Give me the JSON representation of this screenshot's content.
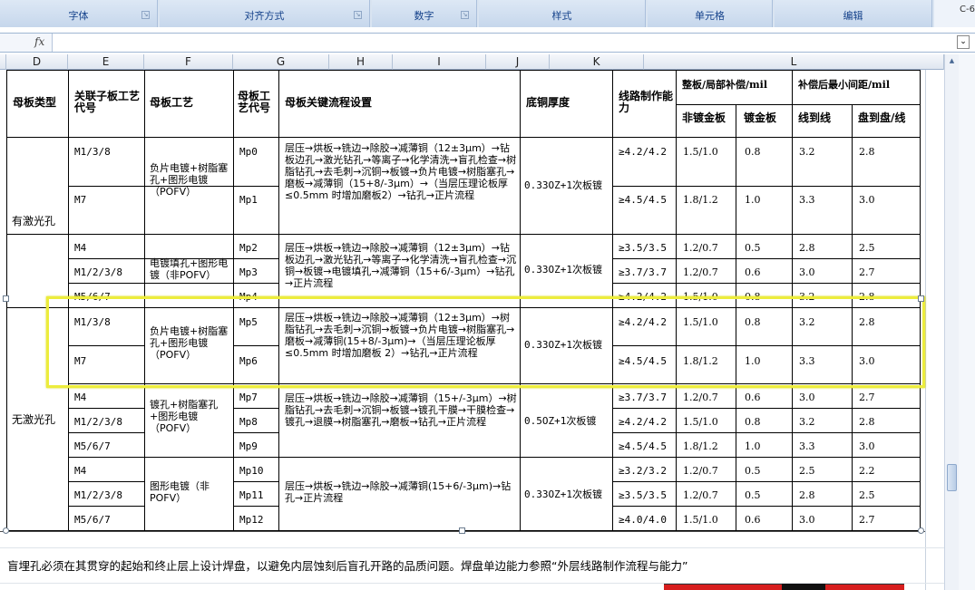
{
  "ribbon": {
    "groups": [
      "字体",
      "对齐方式",
      "数字",
      "样式",
      "单元格",
      "编辑"
    ],
    "right_fragment": "C‑6"
  },
  "formula_bar": {
    "fx_label": "fx",
    "value": ""
  },
  "columns": [
    "D",
    "E",
    "F",
    "G",
    "H",
    "I",
    "J",
    "K",
    "L"
  ],
  "table": {
    "headers": {
      "board_type": "母板类型",
      "sub_code": "关联子板工艺代号",
      "process": "母板工艺",
      "process_code": "母板工艺代号",
      "flow": "母板关键流程设置",
      "cu": "底铜厚度",
      "capability": "线路制作能力",
      "comp": "整板/局部补偿/mil",
      "comp_nongold": "非镀金板",
      "comp_gold": "镀金板",
      "spacing": "补偿后最小间距/mil",
      "line_line": "线到线",
      "pad_line": "盘到盘/线"
    },
    "groups": {
      "laser": "有激光孔",
      "nolaser": "无激光孔"
    },
    "processes": [
      "负片电镀+树脂塞孔+图形电镀（POFV）",
      "电镀填孔+图形电镀（非POFV）",
      "负片电镀+树脂塞孔+图形电镀（POFV）",
      "镀孔+树脂塞孔+图形电镀（POFV）",
      "图形电镀（非POFV）"
    ],
    "flows": [
      "层压→烘板→铣边→除胶→减薄铜（12±3μm）→钻板边孔→激光钻孔→等离子→化学清洗→盲孔检查→树脂钻孔→去毛刺→沉铜→板镀→负片电镀→树脂塞孔→磨板→减薄铜（15+8/-3μm）→（当层压理论板厚≤0.5mm 时增加磨板2）→钻孔→正片流程",
      "层压→烘板→铣边→除胶→减薄铜（12±3μm）→钻板边孔→激光钻孔→等离子→化学清洗→盲孔检查→沉铜→板镀→电镀填孔→减薄铜（15+6/-3μm）→钻孔→正片流程",
      "层压→烘板→铣边→除胶→减薄铜（12±3μm）→树脂钻孔→去毛刺→沉铜→板镀→负片电镀→树脂塞孔→磨板→减薄铜(15+8/-3μm)→（当层压理论板厚≤0.5mm 时增加磨板 2）→钻孔→正片流程",
      "层压→烘板→铣边→除胶→减薄铜（15+/-3μm）→树脂钻孔→去毛刺→沉铜→板镀→镀孔干膜→干膜检查→镀孔→退膜→树脂塞孔→磨板→钻孔→正片流程",
      "层压→烘板→铣边→除胶→减薄铜(15+6/-3μm)→钻孔→正片流程"
    ],
    "copper": [
      "0.33OZ+1次板镀",
      "0.33OZ+1次板镀",
      "0.33OZ+1次板镀",
      "0.5OZ+1次板镀",
      "0.33OZ+1次板镀"
    ],
    "rows": [
      {
        "sub": "M1/3/8",
        "code": "Mp0",
        "cap": "≥4.2/4.2",
        "ng": "1.5/1.0",
        "g": "0.8",
        "ll": "3.2",
        "pl": "2.8"
      },
      {
        "sub": "M7",
        "code": "Mp1",
        "cap": "≥4.5/4.5",
        "ng": "1.8/1.2",
        "g": "1.0",
        "ll": "3.3",
        "pl": "3.0"
      },
      {
        "sub": "M4",
        "code": "Mp2",
        "cap": "≥3.5/3.5",
        "ng": "1.2/0.7",
        "g": "0.5",
        "ll": "2.8",
        "pl": "2.5"
      },
      {
        "sub": "M1/2/3/8",
        "code": "Mp3",
        "cap": "≥3.7/3.7",
        "ng": "1.2/0.7",
        "g": "0.6",
        "ll": "3.0",
        "pl": "2.7"
      },
      {
        "sub": "M5/6/7",
        "code": "Mp4",
        "cap": "≥4.2/4.2",
        "ng": "1.5/1.0",
        "g": "0.8",
        "ll": "3.2",
        "pl": "2.8"
      },
      {
        "sub": "M1/3/8",
        "code": "Mp5",
        "cap": "≥4.2/4.2",
        "ng": "1.5/1.0",
        "g": "0.8",
        "ll": "3.2",
        "pl": "2.8"
      },
      {
        "sub": "M7",
        "code": "Mp6",
        "cap": "≥4.5/4.5",
        "ng": "1.8/1.2",
        "g": "1.0",
        "ll": "3.3",
        "pl": "3.0"
      },
      {
        "sub": "M4",
        "code": "Mp7",
        "cap": "≥3.7/3.7",
        "ng": "1.2/0.7",
        "g": "0.6",
        "ll": "3.0",
        "pl": "2.7"
      },
      {
        "sub": "M1/2/3/8",
        "code": "Mp8",
        "cap": "≥4.2/4.2",
        "ng": "1.5/1.0",
        "g": "0.8",
        "ll": "3.2",
        "pl": "2.8"
      },
      {
        "sub": "M5/6/7",
        "code": "Mp9",
        "cap": "≥4.5/4.5",
        "ng": "1.8/1.2",
        "g": "1.0",
        "ll": "3.3",
        "pl": "3.0"
      },
      {
        "sub": "M4",
        "code": "Mp10",
        "cap": "≥3.2/3.2",
        "ng": "1.2/0.7",
        "g": "0.5",
        "ll": "2.5",
        "pl": "2.2"
      },
      {
        "sub": "M1/2/3/8",
        "code": "Mp11",
        "cap": "≥3.5/3.5",
        "ng": "1.2/0.7",
        "g": "0.5",
        "ll": "2.8",
        "pl": "2.5"
      },
      {
        "sub": "M5/6/7",
        "code": "Mp12",
        "cap": "≥4.0/4.0",
        "ng": "1.5/1.0",
        "g": "0.6",
        "ll": "3.0",
        "pl": "2.7"
      }
    ]
  },
  "footnote": "盲埋孔必须在其贯穿的起始和终止层上设计焊盘，以避免内层蚀刻后盲孔开路的品质问题。焊盘单边能力参照“外层线路制作流程与能力”",
  "colors": {
    "highlight": "#ecec3c",
    "ribbon_text": "#15428b"
  }
}
